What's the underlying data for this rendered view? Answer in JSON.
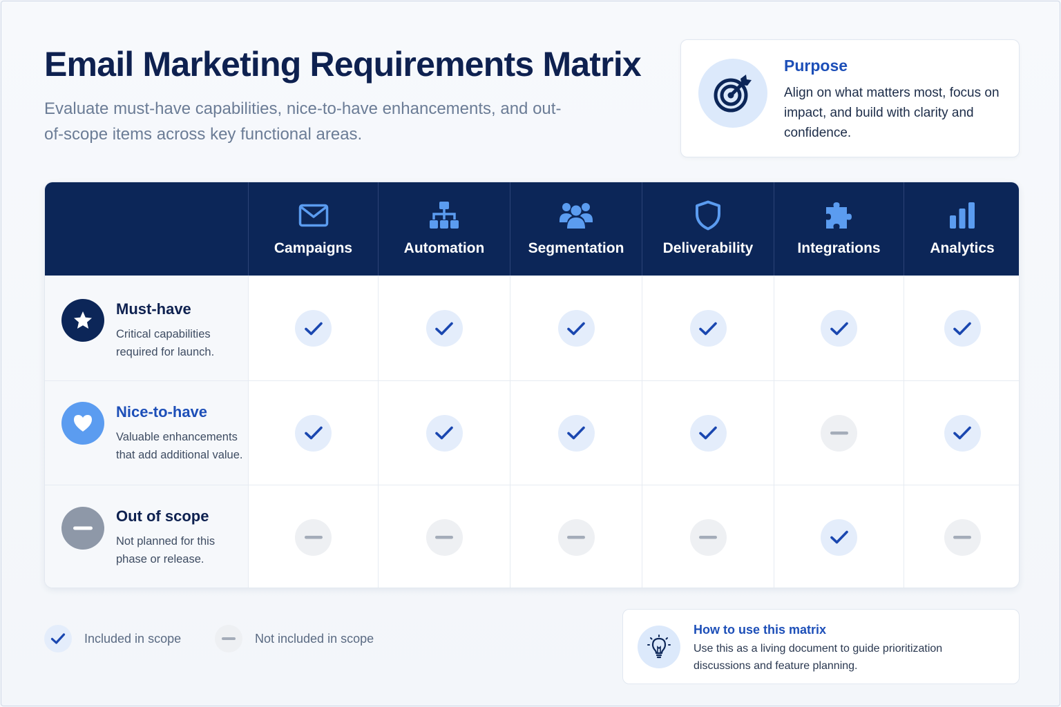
{
  "header": {
    "title": "Email Marketing Requirements Matrix",
    "subtitle": "Evaluate must-have capabilities, nice-to-have enhancements, and out-of-scope items across key functional areas."
  },
  "purpose": {
    "icon": "target-icon",
    "title": "Purpose",
    "text": "Align on what matters most, focus on impact, and build with clarity and confidence."
  },
  "columns": [
    {
      "label": "Campaigns",
      "icon": "envelope-icon"
    },
    {
      "label": "Automation",
      "icon": "hierarchy-icon"
    },
    {
      "label": "Segmentation",
      "icon": "people-icon"
    },
    {
      "label": "Deliverability",
      "icon": "shield-icon"
    },
    {
      "label": "Integrations",
      "icon": "puzzle-icon"
    },
    {
      "label": "Analytics",
      "icon": "bar-chart-icon"
    }
  ],
  "rows": [
    {
      "title": "Must-have",
      "desc": "Critical capabilities required for launch.",
      "icon": "star-icon",
      "icon_color": "#0c2658",
      "title_color": "#0e2150",
      "values": [
        true,
        true,
        true,
        true,
        true,
        true
      ]
    },
    {
      "title": "Nice-to-have",
      "desc": "Valuable enhancements that add additional value.",
      "icon": "heart-icon",
      "icon_color": "#5b9cf0",
      "title_color": "#1d4fb8",
      "values": [
        true,
        true,
        true,
        true,
        false,
        true
      ]
    },
    {
      "title": "Out of scope",
      "desc": "Not planned for this phase or release.",
      "icon": "minus-icon",
      "icon_color": "#8e98a8",
      "title_color": "#0e2150",
      "values": [
        false,
        false,
        false,
        false,
        true,
        false
      ]
    }
  ],
  "legend": {
    "included": "Included in scope",
    "excluded": "Not included in scope"
  },
  "howto": {
    "icon": "lightbulb-icon",
    "title": "How to use this matrix",
    "text": "Use this as a living document to guide prioritization discussions and feature planning."
  },
  "colors": {
    "navy": "#0c2658",
    "accent_blue": "#1d4fb8",
    "check": "#1a47b0",
    "dash": "#a4acb9"
  }
}
